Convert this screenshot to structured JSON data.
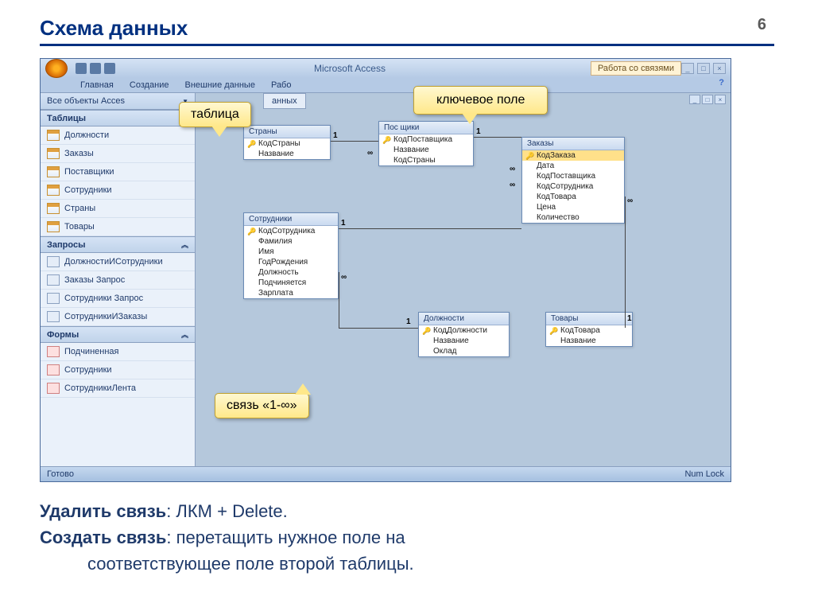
{
  "slide": {
    "title": "Схема данных",
    "number": "6"
  },
  "app": {
    "title": "Microsoft Access",
    "contextual_tab": "Работа со связями"
  },
  "ribbon": {
    "tabs": [
      "Главная",
      "Создание",
      "Внешние данные",
      "Рабо"
    ]
  },
  "nav": {
    "header": "Все объекты Acces",
    "sections": {
      "tables": {
        "title": "Таблицы",
        "items": [
          "Должности",
          "Заказы",
          "Поставщики",
          "Сотрудники",
          "Страны",
          "Товары"
        ]
      },
      "queries": {
        "title": "Запросы",
        "items": [
          "ДолжностиИСотрудники",
          "Заказы Запрос",
          "Сотрудники Запрос",
          "СотрудникиИЗаказы"
        ]
      },
      "forms": {
        "title": "Формы",
        "items": [
          "Подчиненная",
          "Сотрудники",
          "СотрудникиЛента"
        ]
      }
    }
  },
  "doc_tab": "анных",
  "entities": {
    "countries": {
      "title": "Страны",
      "fields": [
        "КодСтраны",
        "Название"
      ],
      "keys": [
        0
      ]
    },
    "suppliers": {
      "title": "Пос             щики",
      "fields": [
        "КодПоставщика",
        "Название",
        "КодСтраны"
      ],
      "keys": [
        0
      ]
    },
    "orders": {
      "title": "Заказы",
      "fields": [
        "КодЗаказа",
        "Дата",
        "КодПоставщика",
        "КодСотрудника",
        "КодТовара",
        "Цена",
        "Количество"
      ],
      "keys": [
        0
      ]
    },
    "employees": {
      "title": "Сотрудники",
      "fields": [
        "КодСотрудника",
        "Фамилия",
        "Имя",
        "ГодРождения",
        "Должность",
        "Подчиняется",
        "Зарплата"
      ],
      "keys": [
        0
      ]
    },
    "positions": {
      "title": "Должности",
      "fields": [
        "КодДолжности",
        "Название",
        "Оклад"
      ],
      "keys": [
        0
      ]
    },
    "goods": {
      "title": "Товары",
      "fields": [
        "КодТовара",
        "Название"
      ],
      "keys": [
        0
      ]
    }
  },
  "callouts": {
    "table": "таблица",
    "keyfield": "ключевое поле",
    "relation": "связь «1-∞»"
  },
  "statusbar": {
    "left": "Готово",
    "right": "Num Lock"
  },
  "relation_labels": {
    "one": "1",
    "many": "∞"
  },
  "notes": {
    "line1_term": "Удалить связь",
    "line1_rest": ": ЛКМ + Delete.",
    "line2_term": "Создать связь",
    "line2_rest": ": перетащить нужное поле на",
    "line3": "соответствующее поле второй таблицы."
  }
}
